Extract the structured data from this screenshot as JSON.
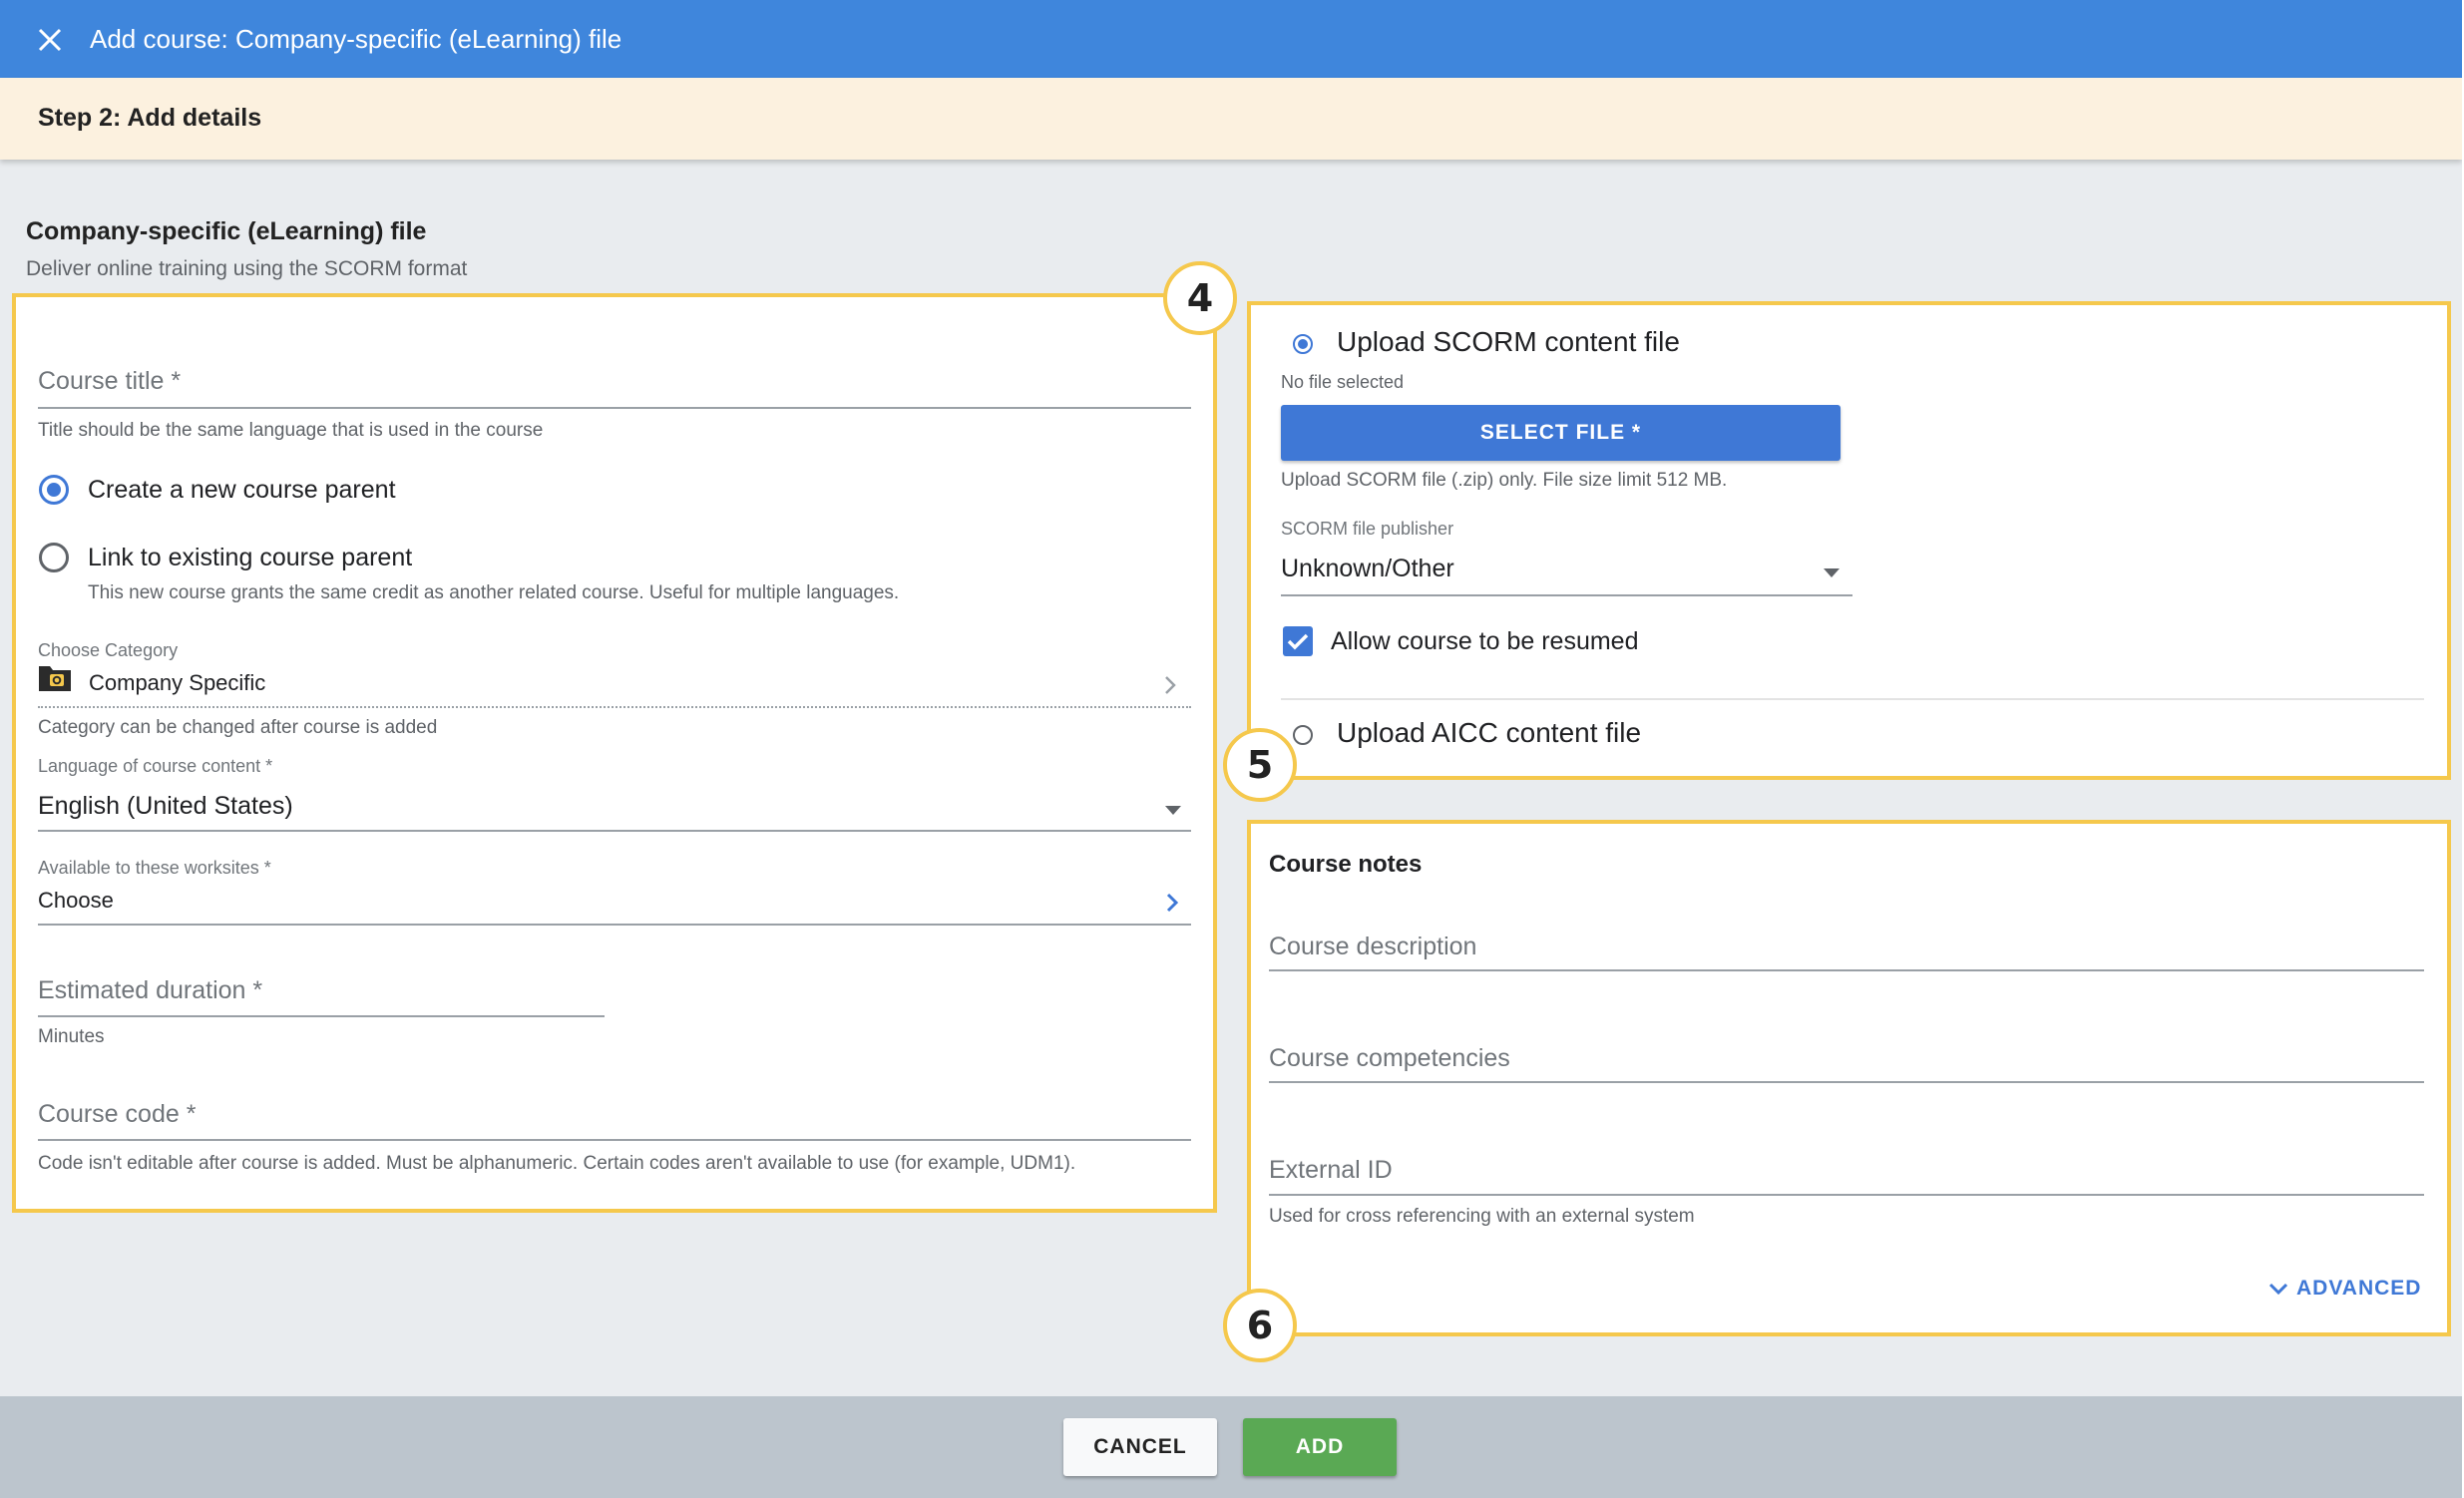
{
  "window": {
    "title": "Add course: Company-specific (eLearning) file",
    "step": "Step 2: Add details"
  },
  "page": {
    "heading": "Company-specific (eLearning) file",
    "subheading": "Deliver online training using the SCORM format"
  },
  "badges": [
    "4",
    "5",
    "6"
  ],
  "details": {
    "course_title_label": "Course title *",
    "course_title_hint": "Title should be the same language that is used in the course",
    "parent_new_label": "Create a new course parent",
    "parent_new_selected": true,
    "parent_link_label": "Link to existing course parent",
    "parent_link_hint": "This new course grants the same credit as another related course. Useful for multiple languages.",
    "category_label": "Choose Category",
    "category_value": "Company Specific",
    "category_hint": "Category can be changed after course is added",
    "language_label": "Language of course content *",
    "language_value": "English (United States)",
    "worksites_label": "Available to these worksites *",
    "worksites_value": "Choose",
    "duration_label": "Estimated duration *",
    "duration_hint": "Minutes",
    "code_label": "Course code *",
    "code_hint": "Code isn't editable after course is added. Must be alphanumeric. Certain codes aren't available to use (for example, UDM1)."
  },
  "upload": {
    "scorm_label": "Upload SCORM content file",
    "scorm_selected": true,
    "file_status": "No file selected",
    "select_file_button": "SELECT FILE *",
    "file_hint": "Upload SCORM file (.zip) only. File size limit 512 MB.",
    "publisher_label": "SCORM file publisher",
    "publisher_value": "Unknown/Other",
    "resume_label": "Allow course to be resumed",
    "resume_checked": true,
    "aicc_label": "Upload AICC content file",
    "aicc_selected": false
  },
  "notes": {
    "title": "Course notes",
    "description_label": "Course description",
    "competencies_label": "Course competencies",
    "external_id_label": "External ID",
    "external_id_hint": "Used for cross referencing with an external system",
    "advanced_label": "ADVANCED"
  },
  "footer": {
    "cancel_label": "CANCEL",
    "add_label": "ADD"
  },
  "colors": {
    "header_blue": "#3f86dc",
    "step_bar": "#fcf1df",
    "highlight_border": "#f5c84c",
    "primary_button": "#3f78d6",
    "add_button": "#5aa954"
  }
}
